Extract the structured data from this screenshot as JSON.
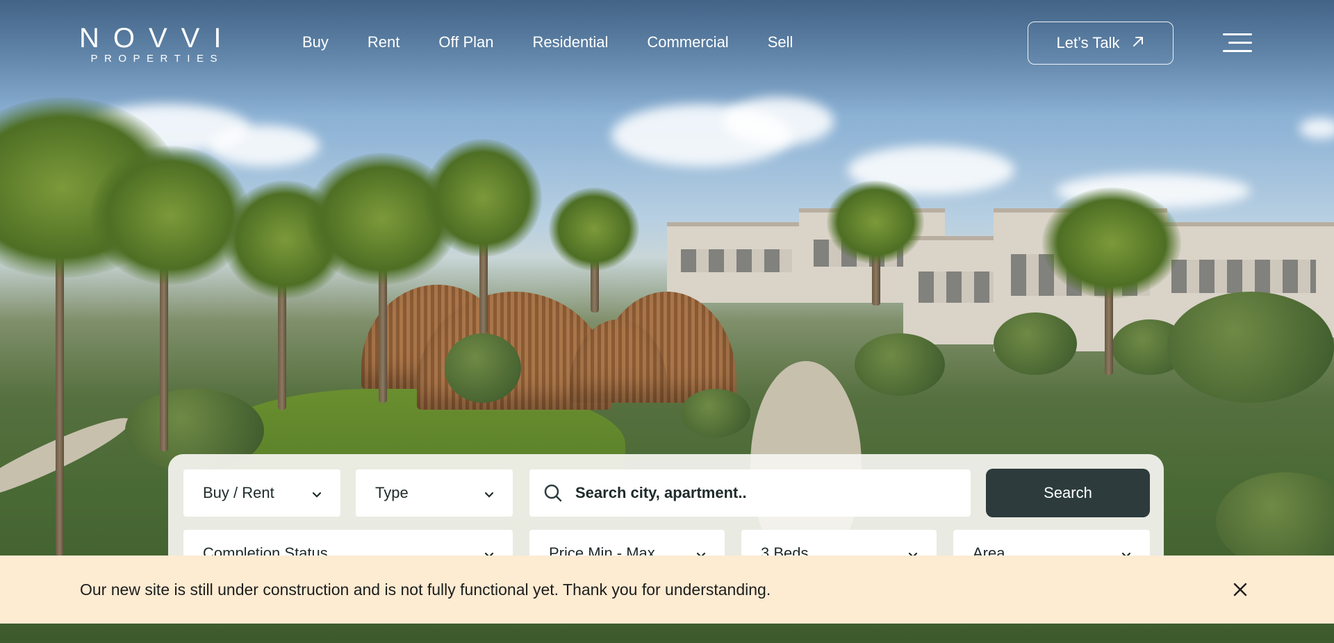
{
  "brand": {
    "name": "NOVVI",
    "tagline": "PROPERTIES"
  },
  "nav": {
    "items": [
      "Buy",
      "Rent",
      "Off Plan",
      "Residential",
      "Commercial",
      "Sell"
    ],
    "cta_label": "Let’s Talk",
    "cta_icon": "arrow-up-right-icon",
    "menu_icon": "hamburger-menu-icon"
  },
  "search": {
    "buy_rent": "Buy / Rent",
    "type": "Type",
    "placeholder": "Search city, apartment..",
    "button_label": "Search",
    "completion_status": "Completion Status",
    "price": "Price Min - Max",
    "beds": "3 Beds",
    "area": "Area"
  },
  "notice": {
    "message": "Our new site is still under construction and is not fully functional yet. Thank you for understanding.",
    "close_icon": "close-icon"
  },
  "colors": {
    "search_button": "#2d3b3d",
    "notice_background": "#fdebd2",
    "text_dark": "#1f2a2a"
  }
}
